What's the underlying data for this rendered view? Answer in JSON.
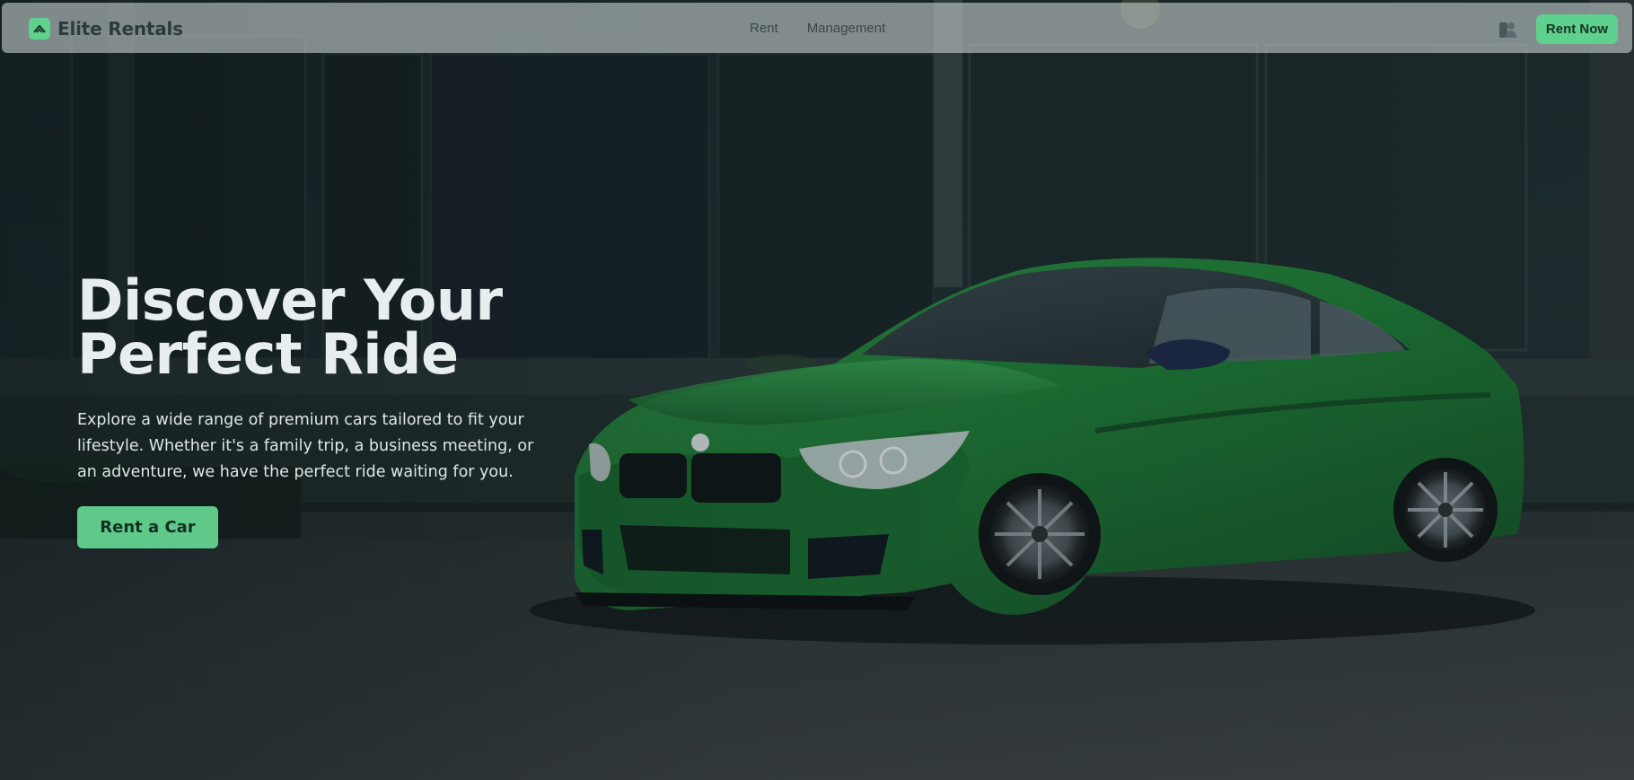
{
  "navbar": {
    "brand_name": "Elite Rentals",
    "brand_icon": "chevron-up-logo-icon",
    "links": [
      {
        "label": "Rent"
      },
      {
        "label": "Management"
      }
    ],
    "user_icon": "user-icon",
    "cta_label": "Rent Now"
  },
  "hero": {
    "title_line1": "Discover Your",
    "title_line2": "Perfect Ride",
    "description": "Explore a wide range of premium cars tailored to fit your lifestyle. Whether it's a family trip, a business meeting, or an adventure, we have the perfect ride waiting for you.",
    "cta_label": "Rent a Car",
    "background": "green-sports-car-photo"
  },
  "colors": {
    "accent": "#5ed18e",
    "navbar_bg": "#c4cccc",
    "hero_text": "#e8eef0",
    "page_bg": "#1b2527"
  }
}
